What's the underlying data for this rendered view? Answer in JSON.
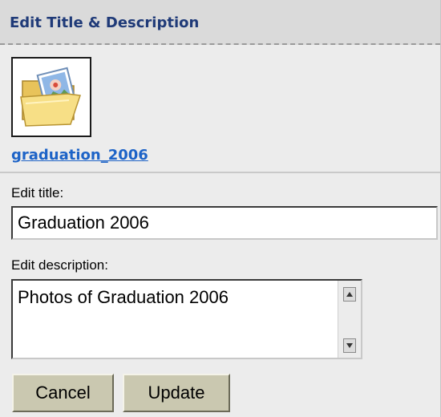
{
  "header": {
    "title": "Edit Title & Description"
  },
  "album": {
    "thumbnail_icon": "photo-folder-icon",
    "link_label": "graduation_2006"
  },
  "form": {
    "title_label": "Edit title:",
    "title_value": "Graduation 2006",
    "description_label": "Edit description:",
    "description_value": "Photos of Graduation 2006"
  },
  "buttons": {
    "cancel_label": "Cancel",
    "update_label": "Update"
  },
  "colors": {
    "header_text": "#1f3a78",
    "link": "#1d63c7",
    "button_face": "#cac8b0",
    "panel_bg": "#ececec",
    "header_bg": "#dadada"
  }
}
